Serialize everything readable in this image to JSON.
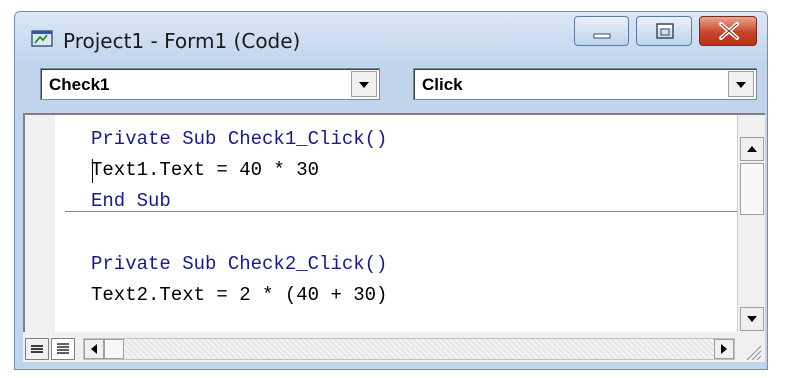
{
  "window": {
    "title": "Project1 - Form1 (Code)"
  },
  "object_combo": {
    "value": "Check1"
  },
  "procedure_combo": {
    "value": "Click"
  },
  "code": {
    "lines": [
      {
        "kw1": "Private Sub ",
        "rest": "Check1_Click()"
      },
      {
        "text": "Text1.Text = 40 * 30"
      },
      {
        "kw1": "End Sub"
      },
      {
        "kw1": "Private Sub ",
        "rest": "Check2_Click()"
      },
      {
        "text": "Text2.Text = 2 * (40 + 30)"
      }
    ]
  },
  "icons": {
    "app": "vb-form-icon",
    "minimize": "minimize-icon",
    "maximize": "maximize-icon",
    "close": "close-icon"
  },
  "colors": {
    "keyword": "#1a1a8c",
    "close_button": "#c7452b",
    "titlebar": "#c2d5ee"
  }
}
